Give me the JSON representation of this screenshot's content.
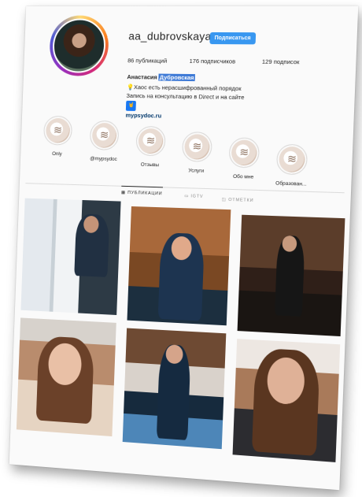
{
  "profile": {
    "username": "aa_dubrovskaya",
    "follow_label": "Подписаться",
    "stats": {
      "posts": "86 публикаций",
      "followers": "176 подписчиков",
      "following": "129 подписок"
    },
    "fullname_first": "Анастасия",
    "fullname_last": "Дубровская",
    "bio_line1": "Хаос есть нерасшифрованный порядок",
    "bio_line2": "Запись на консультацию в Direct и на сайте",
    "bio_badge": "🤘",
    "bio_link": "mypsydoc.ru"
  },
  "highlights": [
    {
      "label": "Only"
    },
    {
      "label": "@mypsydoc"
    },
    {
      "label": "Отзывы"
    },
    {
      "label": "Услуги"
    },
    {
      "label": "Обо мне"
    },
    {
      "label": "Образован..."
    }
  ],
  "tabs": [
    {
      "label": "ПУБЛИКАЦИИ",
      "icon": "grid-icon"
    },
    {
      "label": "IGTV",
      "icon": "tv-icon"
    },
    {
      "label": "ОТМЕТКИ",
      "icon": "tag-icon"
    }
  ],
  "posts": [
    {
      "icon": "photo"
    },
    {
      "icon": "photo"
    },
    {
      "icon": "photo"
    },
    {
      "icon": "photo"
    },
    {
      "icon": "photo"
    },
    {
      "icon": "photo"
    }
  ]
}
